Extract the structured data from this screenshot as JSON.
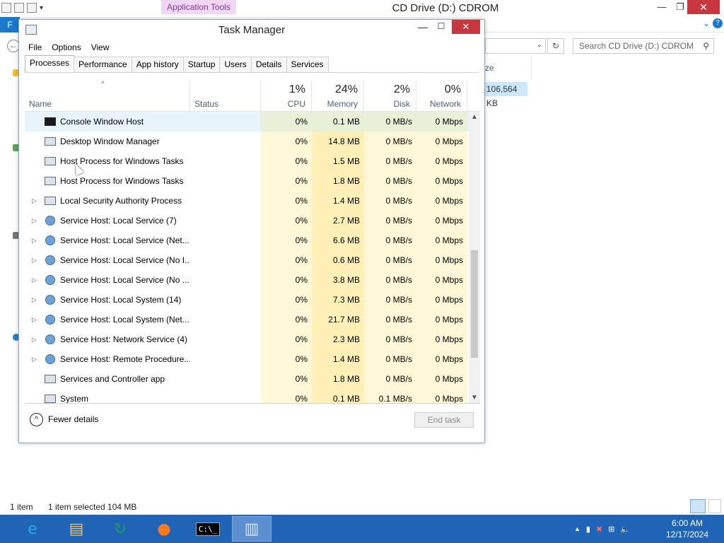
{
  "explorer": {
    "app_tools_label": "Application Tools",
    "title": "CD Drive (D:) CDROM",
    "minimize_glyph": "—",
    "restore_glyph": "❐",
    "close_glyph": "✕",
    "file_tab_label": "F",
    "ribbon_expand_glyph": "⌄",
    "help_glyph": "?",
    "back_glyph": "←",
    "refresh_glyph": "↻",
    "address_dropdown_glyph": "⌄",
    "search_placeholder": "Search CD Drive (D:) CDROM",
    "search_icon_glyph": "⚲",
    "column_size_label": "ze",
    "size_value": "106,564 KB",
    "status_items": "1 item",
    "status_selected": "1 item selected  104 MB"
  },
  "task_manager": {
    "title": "Task Manager",
    "minimize_glyph": "—",
    "maximize_glyph": "☐",
    "close_glyph": "✕",
    "menu": [
      "File",
      "Options",
      "View"
    ],
    "tabs": [
      "Processes",
      "Performance",
      "App history",
      "Startup",
      "Users",
      "Details",
      "Services"
    ],
    "active_tab": "Processes",
    "sort_glyph": "^",
    "columns": {
      "name": "Name",
      "status": "Status",
      "cpu": {
        "label": "CPU",
        "percent": "1%"
      },
      "memory": {
        "label": "Memory",
        "percent": "24%"
      },
      "disk": {
        "label": "Disk",
        "percent": "2%"
      },
      "network": {
        "label": "Network",
        "percent": "0%"
      }
    },
    "processes": [
      {
        "name": "Console Window Host",
        "icon": "console-icon",
        "expandable": false,
        "cpu": "0%",
        "memory": "0.1 MB",
        "disk": "0 MB/s",
        "network": "0 Mbps",
        "selected": true
      },
      {
        "name": "Desktop Window Manager",
        "icon": "window-icon",
        "expandable": false,
        "cpu": "0%",
        "memory": "14.8 MB",
        "disk": "0 MB/s",
        "network": "0 Mbps"
      },
      {
        "name": "Host Process for Windows Tasks",
        "icon": "window-icon",
        "expandable": false,
        "cpu": "0%",
        "memory": "1.5 MB",
        "disk": "0 MB/s",
        "network": "0 Mbps"
      },
      {
        "name": "Host Process for Windows Tasks",
        "icon": "window-icon",
        "expandable": false,
        "cpu": "0%",
        "memory": "1.8 MB",
        "disk": "0 MB/s",
        "network": "0 Mbps"
      },
      {
        "name": "Local Security Authority Process",
        "icon": "window-icon",
        "expandable": true,
        "cpu": "0%",
        "memory": "1.4 MB",
        "disk": "0 MB/s",
        "network": "0 Mbps"
      },
      {
        "name": "Service Host: Local Service (7)",
        "icon": "gear-icon",
        "expandable": true,
        "cpu": "0%",
        "memory": "2.7 MB",
        "disk": "0 MB/s",
        "network": "0 Mbps"
      },
      {
        "name": "Service Host: Local Service (Net...",
        "icon": "gear-icon",
        "expandable": true,
        "cpu": "0%",
        "memory": "6.6 MB",
        "disk": "0 MB/s",
        "network": "0 Mbps"
      },
      {
        "name": "Service Host: Local Service (No I...",
        "icon": "gear-icon",
        "expandable": true,
        "cpu": "0%",
        "memory": "0.6 MB",
        "disk": "0 MB/s",
        "network": "0 Mbps"
      },
      {
        "name": "Service Host: Local Service (No ...",
        "icon": "gear-icon",
        "expandable": true,
        "cpu": "0%",
        "memory": "3.8 MB",
        "disk": "0 MB/s",
        "network": "0 Mbps"
      },
      {
        "name": "Service Host: Local System (14)",
        "icon": "gear-icon",
        "expandable": true,
        "cpu": "0%",
        "memory": "7.3 MB",
        "disk": "0 MB/s",
        "network": "0 Mbps"
      },
      {
        "name": "Service Host: Local System (Net...",
        "icon": "gear-icon",
        "expandable": true,
        "cpu": "0%",
        "memory": "21.7 MB",
        "disk": "0 MB/s",
        "network": "0 Mbps"
      },
      {
        "name": "Service Host: Network Service (4)",
        "icon": "gear-icon",
        "expandable": true,
        "cpu": "0%",
        "memory": "2.3 MB",
        "disk": "0 MB/s",
        "network": "0 Mbps"
      },
      {
        "name": "Service Host: Remote Procedure...",
        "icon": "gear-icon",
        "expandable": true,
        "cpu": "0%",
        "memory": "1.4 MB",
        "disk": "0 MB/s",
        "network": "0 Mbps"
      },
      {
        "name": "Services and Controller app",
        "icon": "window-icon",
        "expandable": false,
        "cpu": "0%",
        "memory": "1.8 MB",
        "disk": "0 MB/s",
        "network": "0 Mbps"
      },
      {
        "name": "System",
        "icon": "window-icon",
        "expandable": false,
        "cpu": "0%",
        "memory": "0.1 MB",
        "disk": "0.1 MB/s",
        "network": "0 Mbps"
      }
    ],
    "expander_glyph": "▷",
    "scroll_up_glyph": "▲",
    "scroll_down_glyph": "▼",
    "fewer_details_glyph": "^",
    "fewer_details_label": "Fewer details",
    "end_task_label": "End task"
  },
  "taskbar": {
    "buttons": [
      {
        "name": "internet-explorer-icon",
        "glyph": "e",
        "color": "#2ea6e8",
        "active": false
      },
      {
        "name": "file-explorer-icon",
        "glyph": "▤",
        "color": "#f1c65a",
        "active": false
      },
      {
        "name": "app-refresh-icon",
        "glyph": "↻",
        "color": "#17a05d",
        "active": false
      },
      {
        "name": "firefox-icon",
        "glyph": "●",
        "color": "#ff7a1a",
        "active": false
      },
      {
        "name": "command-prompt-icon",
        "glyph": "C:\\_",
        "color": "#ffffff",
        "active": false
      },
      {
        "name": "task-manager-icon",
        "glyph": "▥",
        "color": "#d8e4f0",
        "active": true
      }
    ],
    "tray": {
      "show_hidden_glyph": "▲",
      "flag_glyph": "▮",
      "action_center_glyph": "✖",
      "network_glyph": "⊞",
      "volume_glyph": "🔈"
    },
    "time": "6:00 AM",
    "date": "12/17/2024"
  }
}
